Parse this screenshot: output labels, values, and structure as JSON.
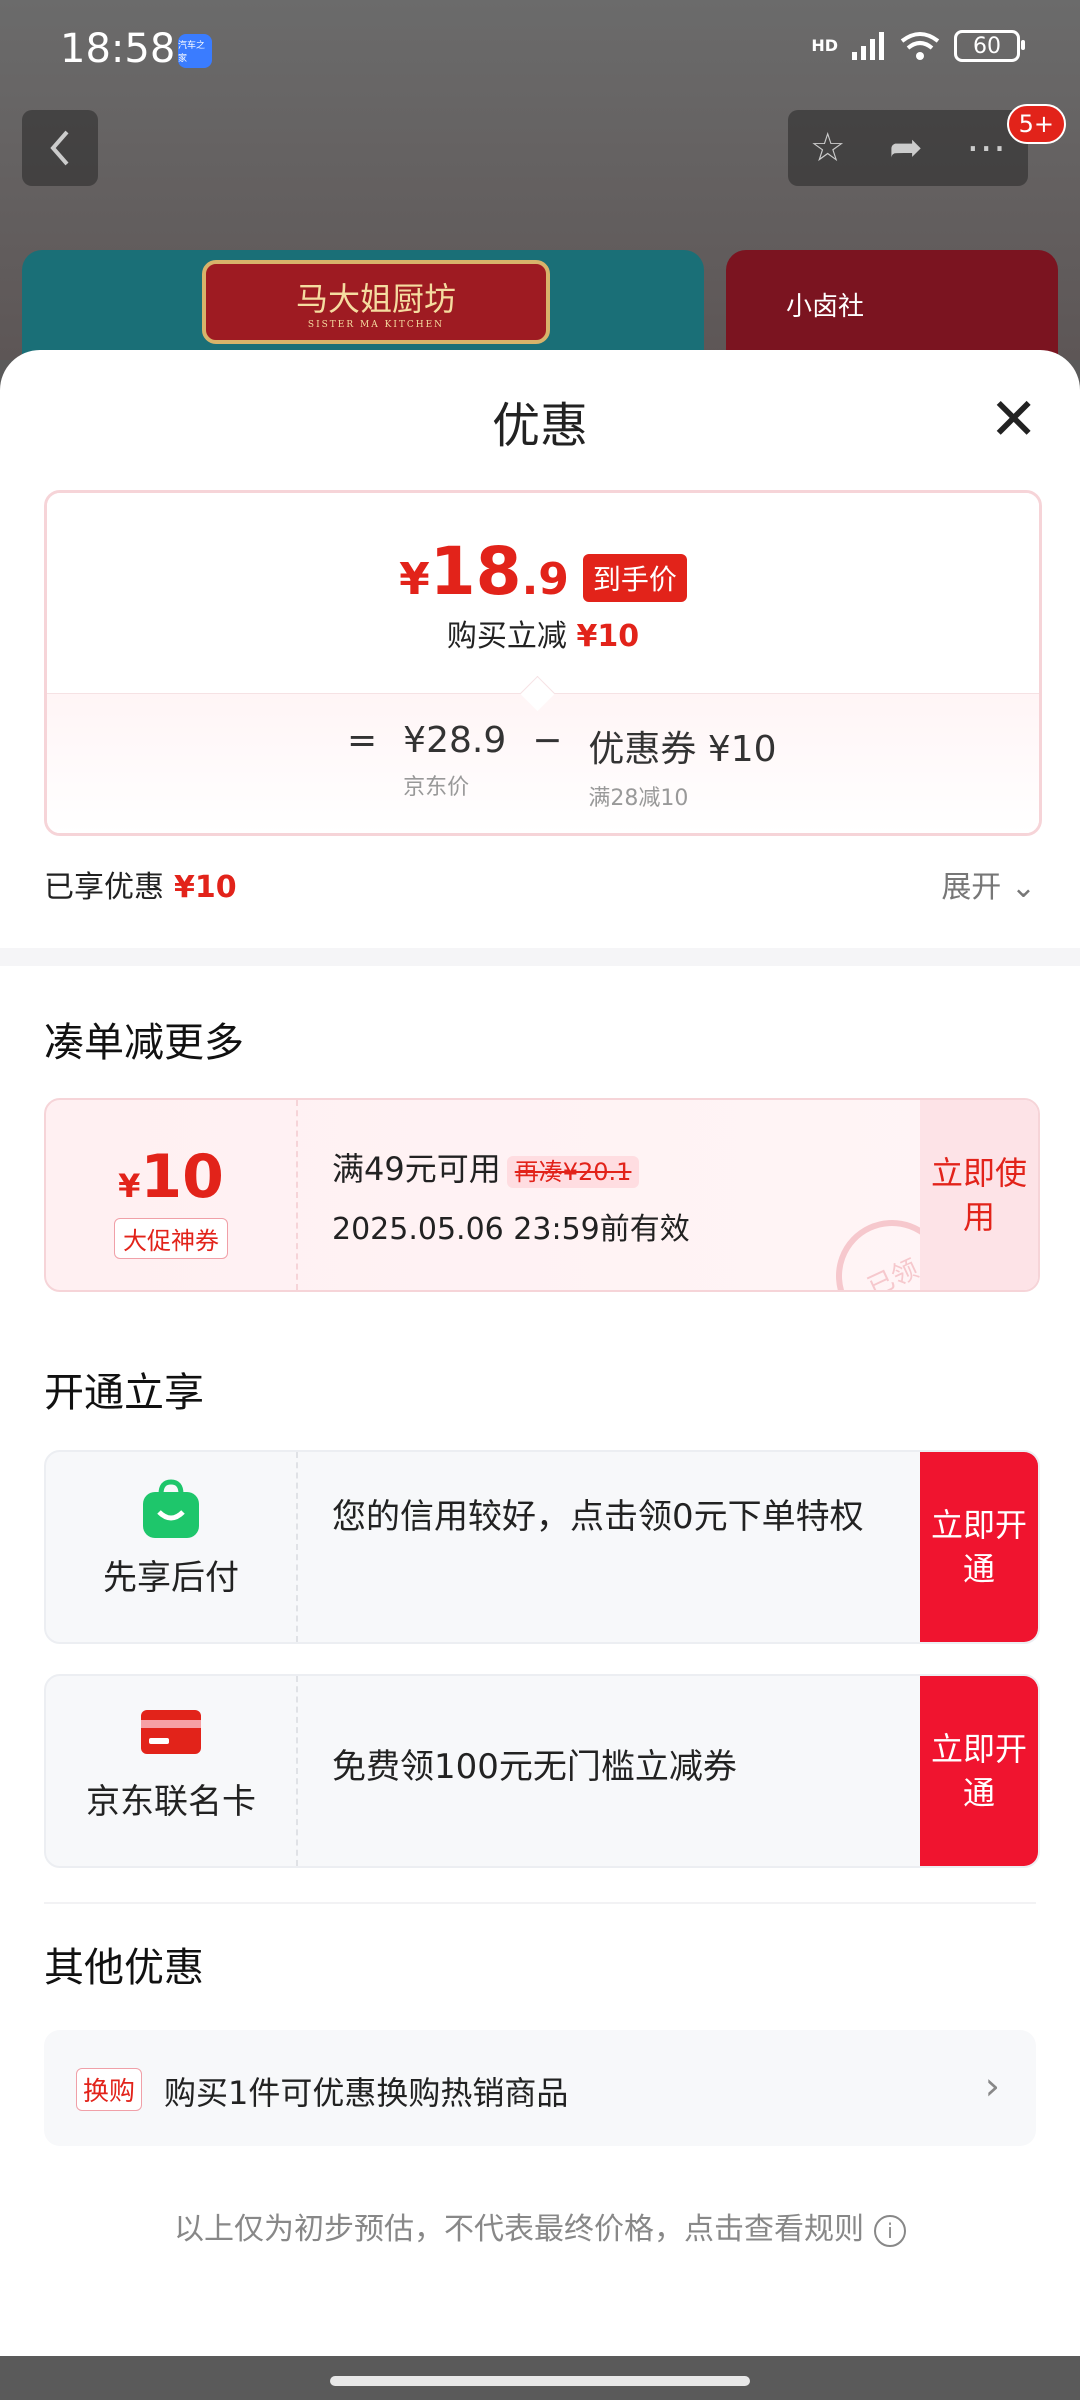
{
  "status_bar": {
    "time": "18:58",
    "app_badge": "汽车之家",
    "network": "HD",
    "battery": "60"
  },
  "nav": {
    "badge_count": "5+"
  },
  "banners": {
    "left_logo": "马大姐厨坊",
    "left_logo_sub": "SISTER MA KITCHEN",
    "right_text": "小卤社"
  },
  "sheet": {
    "title": "优惠",
    "close_icon": "close-icon"
  },
  "price_card": {
    "currency": "¥",
    "final_int": "18",
    "final_dec": ".9",
    "final_tag": "到手价",
    "reduce_label": "购买立减",
    "reduce_amount": "¥10",
    "equals": "=",
    "jd_price": "¥28.9",
    "jd_price_label": "京东价",
    "minus": "−",
    "coupon_text": "优惠券 ¥10",
    "coupon_rule": "满28减10"
  },
  "enjoyed": {
    "label": "已享优惠",
    "amount": "¥10",
    "expand": "展开"
  },
  "section_more": {
    "title": "凑单减更多"
  },
  "coupon": {
    "currency": "¥",
    "amount": "10",
    "type": "大促神券",
    "condition": "满49元可用",
    "again": "再凑¥20.1",
    "expiry": "2025.05.06 23:59前有效",
    "action": "立即使用",
    "stamp": "已领"
  },
  "section_open": {
    "title": "开通立享"
  },
  "services": [
    {
      "name": "先享后付",
      "text": "您的信用较好，点击领0元下单特权",
      "action": "立即开通",
      "color": "#1ec66b"
    },
    {
      "name": "京东联名卡",
      "text": "免费领100元无门槛立减券",
      "action": "立即开通",
      "color": "#e2231a"
    }
  ],
  "section_other": {
    "title": "其他优惠"
  },
  "other": {
    "tag": "换购",
    "text": "购买1件可优惠换购热销商品"
  },
  "footnote": {
    "text": "以上仅为初步预估，不代表最终价格，点击查看规则",
    "icon": "i"
  }
}
